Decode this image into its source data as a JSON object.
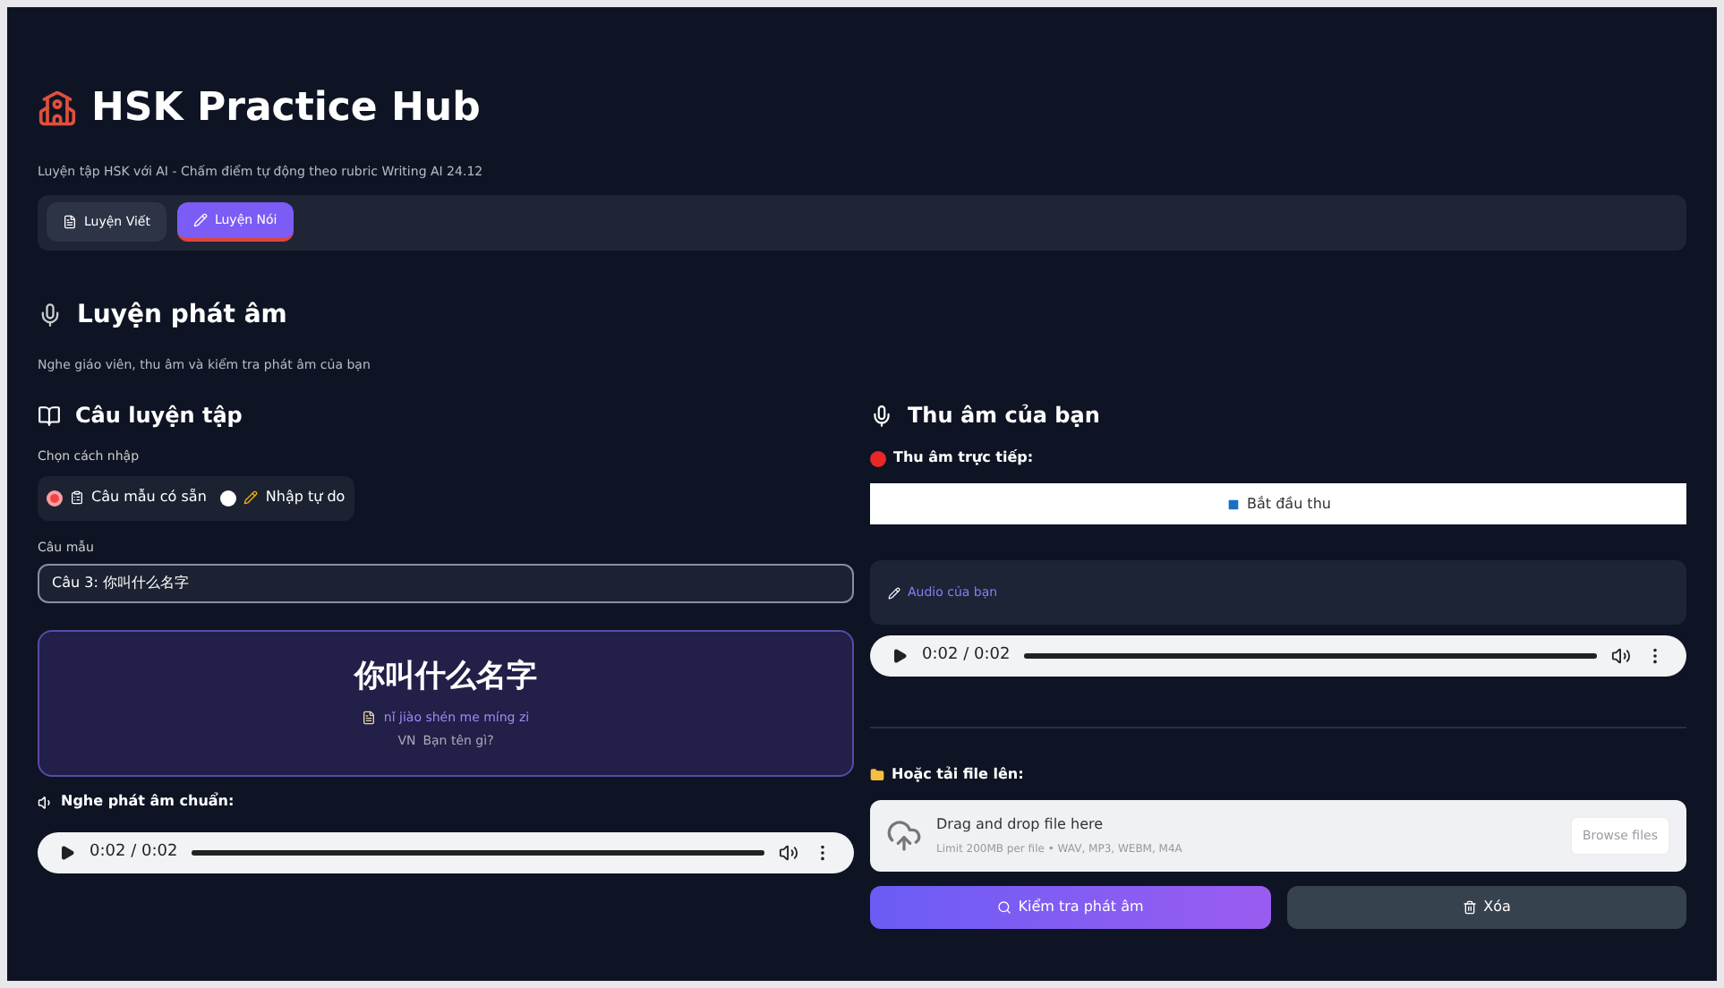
{
  "header": {
    "title": "HSK Practice Hub",
    "subtitle": "Luyện tập HSK với AI - Chấm điểm tự động theo rubric Writing AI 24.12"
  },
  "tabs": [
    {
      "label": "Luyện Viết",
      "selected": false
    },
    {
      "label": "Luyện Nói",
      "selected": true
    }
  ],
  "section": {
    "title": "Luyện phát âm",
    "description": "Nghe giáo viên, thu âm và kiểm tra phát âm của bạn"
  },
  "left": {
    "title": "Câu luyện tập",
    "input_mode_label": "Chọn cách nhập",
    "input_modes": [
      {
        "label": "Câu mẫu có sẵn",
        "selected": true
      },
      {
        "label": "Nhập tự do",
        "selected": false
      }
    ],
    "sample_label": "Câu mẫu",
    "sample_value": "Câu 3: 你叫什么名字",
    "card": {
      "hanzi": "你叫什么名字",
      "pinyin": "nǐ jiào shén me míng zi",
      "flag": "VN",
      "meaning": "Bạn tên gì?"
    },
    "listen_label": "Nghe phát âm chuẩn:",
    "audio": {
      "time": "0:02 / 0:02",
      "level": 1
    }
  },
  "right": {
    "title": "Thu âm của bạn",
    "live_label": "Thu âm trực tiếp:",
    "record_button": "Bắt đầu thu",
    "audio_panel_label": "Audio của bạn",
    "audio": {
      "time": "0:02 / 0:02",
      "level": 1
    },
    "upload_label": "Hoặc tải file lên:",
    "uploader": {
      "title": "Drag and drop file here",
      "hint": "Limit 200MB per file • WAV, MP3, WEBM, M4A",
      "browse": "Browse files"
    },
    "buttons": [
      {
        "label": "Kiểm tra phát âm",
        "kind": "primary"
      },
      {
        "label": "Xóa",
        "kind": "secondary"
      }
    ]
  }
}
